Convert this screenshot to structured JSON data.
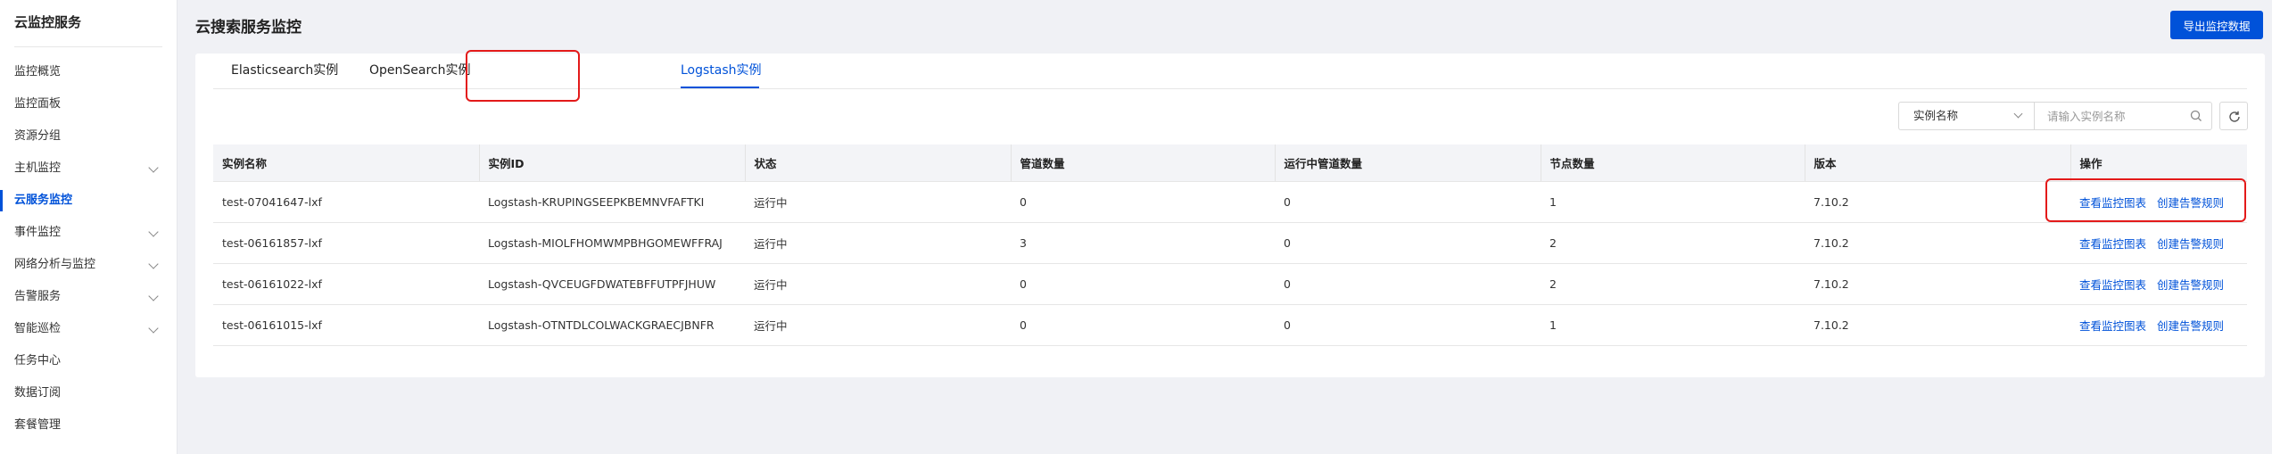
{
  "sidebar": {
    "title": "云监控服务",
    "items": [
      {
        "label": "监控概览",
        "expandable": false
      },
      {
        "label": "监控面板",
        "expandable": false
      },
      {
        "label": "资源分组",
        "expandable": false
      },
      {
        "label": "主机监控",
        "expandable": true
      },
      {
        "label": "云服务监控",
        "expandable": false,
        "active": true
      },
      {
        "label": "事件监控",
        "expandable": true
      },
      {
        "label": "网络分析与监控",
        "expandable": true
      },
      {
        "label": "告警服务",
        "expandable": true
      },
      {
        "label": "智能巡检",
        "expandable": true
      },
      {
        "label": "任务中心",
        "expandable": false
      },
      {
        "label": "数据订阅",
        "expandable": false
      },
      {
        "label": "套餐管理",
        "expandable": false
      }
    ]
  },
  "header": {
    "title": "云搜索服务监控",
    "export_label": "导出监控数据"
  },
  "tabs": [
    {
      "label": "Elasticsearch实例"
    },
    {
      "label": "OpenSearch实例"
    },
    {
      "label": "Logstash实例",
      "active": true
    }
  ],
  "filter": {
    "select_value": "实例名称",
    "search_placeholder": "请输入实例名称"
  },
  "table": {
    "columns": [
      "实例名称",
      "实例ID",
      "状态",
      "管道数量",
      "运行中管道数量",
      "节点数量",
      "版本",
      "操作"
    ],
    "rows": [
      {
        "name": "test-07041647-lxf",
        "id": "Logstash-KRUPINGSEEPKBEMNVFAFTKI",
        "status": "运行中",
        "pipelines": "0",
        "running_pipelines": "0",
        "nodes": "1",
        "version": "7.10.2"
      },
      {
        "name": "test-06161857-lxf",
        "id": "Logstash-MIOLFHOMWMPBHGOMEWFFRAJ",
        "status": "运行中",
        "pipelines": "3",
        "running_pipelines": "0",
        "nodes": "2",
        "version": "7.10.2"
      },
      {
        "name": "test-06161022-lxf",
        "id": "Logstash-QVCEUGFDWATEBFFUTPFJHUW",
        "status": "运行中",
        "pipelines": "0",
        "running_pipelines": "0",
        "nodes": "2",
        "version": "7.10.2"
      },
      {
        "name": "test-06161015-lxf",
        "id": "Logstash-OTNTDLCOLWACKGRAECJBNFR",
        "status": "运行中",
        "pipelines": "0",
        "running_pipelines": "0",
        "nodes": "1",
        "version": "7.10.2"
      }
    ],
    "actions": {
      "view_chart": "查看监控图表",
      "create_alarm": "创建告警规则"
    }
  },
  "colors": {
    "primary": "#0052d9",
    "highlight": "#e31a1a",
    "background": "#f0f1f5"
  }
}
